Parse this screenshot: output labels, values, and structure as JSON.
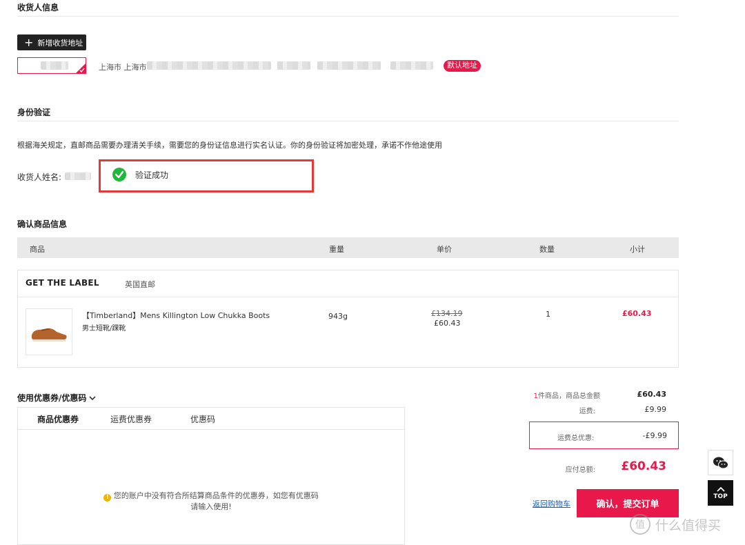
{
  "consignee": {
    "title": "收货人信息",
    "add_address_label": "新增收货地址",
    "address_region": "上海市 上海市",
    "default_tag": "默认地址"
  },
  "identity": {
    "title": "身份验证",
    "notice": "根据海关规定，直邮商品需要办理清关手续，需要您的身份证信息进行实名认证。你的身份验证将加密处理，承诺不作他途使用",
    "name_label": "收货人姓名:",
    "verify_status": "验证成功"
  },
  "products": {
    "title": "确认商品信息",
    "headers": [
      "商品",
      "重量",
      "单价",
      "数量",
      "小计"
    ],
    "store_name": "GET THE LABEL",
    "shipping_method": "英国直邮",
    "item": {
      "name": "【Timberland】Mens Killington Low Chukka Boots",
      "category": "男士短靴/踝靴",
      "weight": "943g",
      "original_price": "£134.19",
      "price": "£60.43",
      "quantity": "1",
      "subtotal": "£60.43"
    }
  },
  "coupon": {
    "toggle_label": "使用优惠券/优惠码",
    "tabs": [
      "商品优惠券",
      "运费优惠券",
      "优惠码"
    ],
    "empty_message_line1": "您的账户中没有符合所结算商品条件的优惠券，如您有优惠码",
    "empty_message_line2": "请输入使用!"
  },
  "summary": {
    "item_count": "1",
    "items_total_label": "件商品，商品总金额",
    "items_total": "£60.43",
    "shipping_label": "运费:",
    "shipping": "£9.99",
    "shipping_discount_label": "运费总优惠:",
    "shipping_discount": "-£9.99",
    "payable_label": "应付总额:",
    "payable": "£60.43",
    "back_to_cart": "返回购物车",
    "submit_label": "确认，提交订单"
  },
  "sidebar": {
    "top_label": "TOP"
  },
  "watermark": {
    "text": "什么值得买"
  },
  "colors": {
    "accent_red": "#e8194a",
    "highlight_border": "#e53935",
    "success_green": "#1fb83a"
  }
}
